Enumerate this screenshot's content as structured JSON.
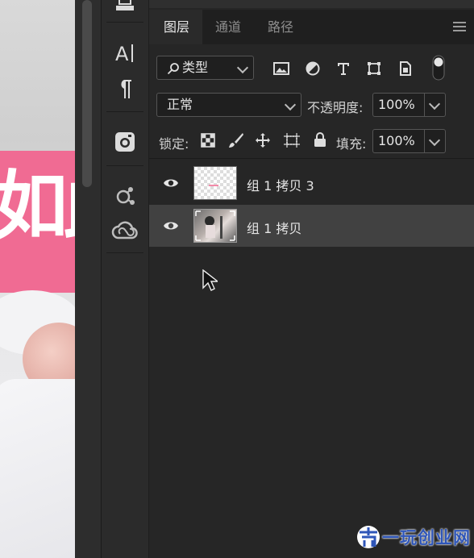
{
  "canvas": {
    "overlay_text": "如此"
  },
  "tools": [
    {
      "icon": "3d-print-icon"
    },
    {
      "icon": "character-panel-icon"
    },
    {
      "icon": "paragraph-icon"
    },
    {
      "icon": "instagram-icon"
    },
    {
      "icon": "libraries-icon"
    },
    {
      "icon": "creative-cloud-icon"
    }
  ],
  "tabs": [
    {
      "label": "图层",
      "active": true
    },
    {
      "label": "通道",
      "active": false
    },
    {
      "label": "路径",
      "active": false
    }
  ],
  "filter": {
    "kind_label": "类型",
    "icons": [
      "image-filter-icon",
      "adjustment-filter-icon",
      "type-filter-icon",
      "shape-filter-icon",
      "smart-object-filter-icon",
      "filter-toggle-icon"
    ]
  },
  "blend": {
    "mode": "正常",
    "opacity_label": "不透明度:",
    "opacity_value": "100%"
  },
  "lock": {
    "label": "锁定:",
    "icons": [
      "lock-transparent-icon",
      "lock-image-icon",
      "lock-position-icon",
      "lock-artboard-icon",
      "lock-all-icon"
    ],
    "fill_label": "填充:",
    "fill_value": "100%"
  },
  "layers": [
    {
      "name": "组 1 拷贝 3",
      "visible": true,
      "selected": false,
      "thumb": "transparent"
    },
    {
      "name": "组 1 拷贝",
      "visible": true,
      "selected": true,
      "thumb": "photo"
    }
  ],
  "watermark": {
    "text": "一玩创业网"
  },
  "colors": {
    "panel_bg": "#262626",
    "selected_row": "#414141",
    "canvas_pink": "#f06b93",
    "watermark_blue": "#2f56b8"
  }
}
